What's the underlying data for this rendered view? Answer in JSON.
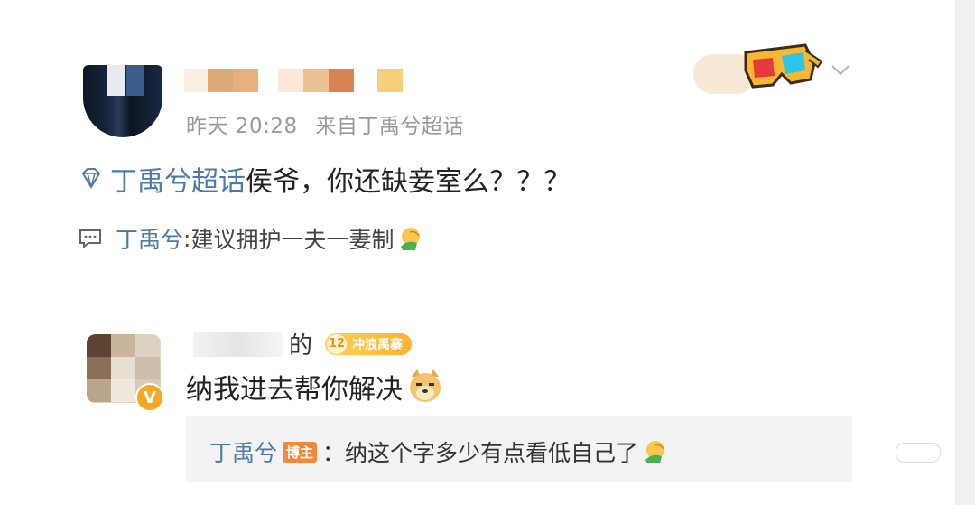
{
  "post1": {
    "time": "昨天 20:28",
    "source": "来自丁禹兮超话",
    "topic": "丁禹兮超话",
    "text": "侯爷，你还缺妾室么？？？",
    "reply": {
      "author": "丁禹兮",
      "separator": ": ",
      "text": "建议拥护一夫一妻制"
    },
    "icons": [
      "diamond-topic-icon",
      "comment-icon",
      "facepalm-emoji",
      "3d-glasses-decoration",
      "chevron-down-icon"
    ]
  },
  "post2": {
    "name_suffix": "的",
    "fan_badge": {
      "level": "12",
      "name": "冲浪禹寨"
    },
    "verified": "V",
    "text": "纳我进去帮你解决",
    "sub_reply": {
      "author": "丁禹兮",
      "tag": "博主",
      "separator": "：",
      "text": "纳这个字多少有点看低自己了"
    }
  },
  "colors": {
    "link_blue": "#4d7aa8",
    "meta_gray": "#9a9a9a",
    "fan_badge": "#ffb02e",
    "blogger_tag": "#f08a3a",
    "verified": "#f5a623"
  }
}
